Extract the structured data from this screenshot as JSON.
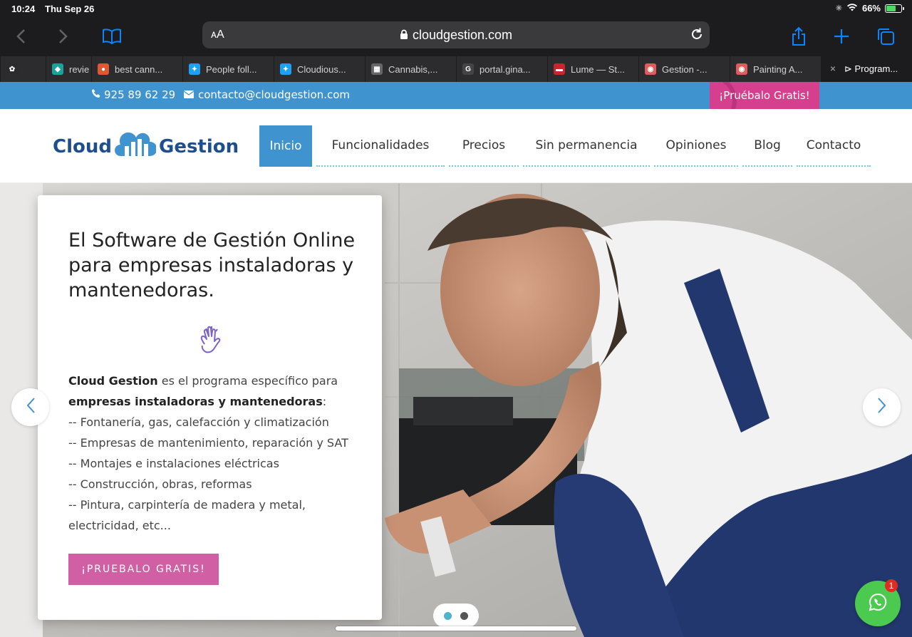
{
  "status_bar": {
    "time": "10:24",
    "date": "Thu Sep 26",
    "battery": "66%",
    "battery_level": 0.66
  },
  "browser": {
    "aa_label": "AA",
    "url": "cloudgestion.com",
    "tabs": [
      {
        "label": "",
        "icon": "cannabis-icon",
        "color": "#2b2b2b"
      },
      {
        "label": "revie",
        "icon": "review-icon",
        "color": "#1aa39a"
      },
      {
        "label": "best cann...",
        "icon": "duckduckgo-icon",
        "color": "#de5833"
      },
      {
        "label": "People foll...",
        "icon": "twitter-icon",
        "color": "#1da1f2"
      },
      {
        "label": "Cloudious...",
        "icon": "twitter-icon",
        "color": "#1da1f2"
      },
      {
        "label": "Cannabis,...",
        "icon": "image-icon",
        "color": "#666666"
      },
      {
        "label": "portal.gina...",
        "icon": "g-icon",
        "color": "#444444"
      },
      {
        "label": "Lume — St...",
        "icon": "lume-icon",
        "color": "#c4272d"
      },
      {
        "label": "Gestion -...",
        "icon": "brand-icon",
        "color": "#e25b5b"
      },
      {
        "label": "Painting A...",
        "icon": "brand-icon",
        "color": "#e25b5b"
      },
      {
        "label": "⊳ Program...",
        "icon": "close-icon",
        "color": "#8e8e93",
        "active": true
      }
    ]
  },
  "topbar": {
    "phone": "925 89 62 29",
    "email": "contacto@cloudgestion.com",
    "cta": "¡Pruébalo Gratis!"
  },
  "header": {
    "logo_left": "Cloud",
    "logo_right": "Gestion",
    "nav": [
      {
        "label": "Inicio",
        "active": true
      },
      {
        "label": "Funcionalidades"
      },
      {
        "label": "Precios"
      },
      {
        "label": "Sin permanencia"
      },
      {
        "label": "Opiniones"
      },
      {
        "label": "Blog"
      },
      {
        "label": "Contacto"
      }
    ]
  },
  "hero": {
    "title": "El Software de Gestión Online para empresas instaladoras y mantenedoras.",
    "intro_brand": "Cloud Gestion",
    "intro_text": " es el programa específico para ",
    "intro_bold": "empresas instaladoras y mantenedoras",
    "intro_colon": ":",
    "list": [
      "-- Fontanería, gas, calefacción y climatización",
      "-- Empresas de mantenimiento, reparación y SAT",
      "-- Montajes e instalaciones eléctricas",
      "-- Construcción, obras, reformas",
      "-- Pintura, carpintería de madera y metal, electricidad, etc..."
    ],
    "button": "¡PRUEBALO GRATIS!",
    "slide_count": 2,
    "active_slide": 1
  },
  "whatsapp": {
    "badge": "1"
  },
  "colors": {
    "primary": "#3f93cf",
    "accent": "#d63f8e",
    "button": "#d05fa4",
    "logo": "#1f4e8c",
    "whatsapp": "#4cc94f"
  }
}
